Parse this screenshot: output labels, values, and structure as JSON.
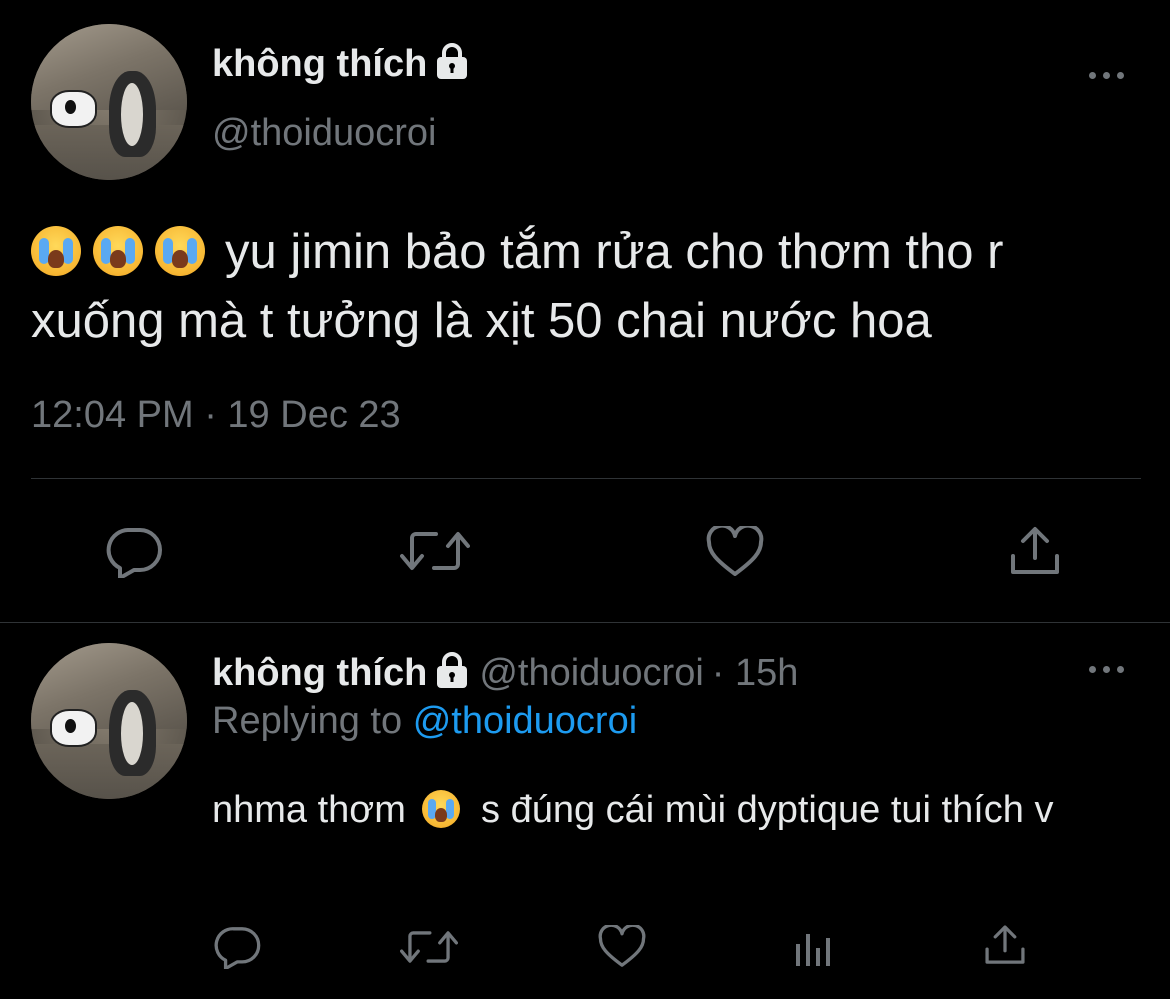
{
  "tweet": {
    "display_name": "không thích",
    "handle": "@thoiduocroi",
    "text": "yu jimin bảo tắm rửa cho thơm tho r xuống mà t tưởng là xịt 50 chai nước hoa",
    "emoji_prefix": [
      "loudly-crying-face",
      "loudly-crying-face",
      "loudly-crying-face"
    ],
    "timestamp": "12:04 PM · 19 Dec 23",
    "actions": [
      "reply-icon",
      "retweet-icon",
      "like-icon",
      "share-icon"
    ]
  },
  "reply": {
    "display_name": "không thích",
    "handle": "@thoiduocroi",
    "age": "· 15h",
    "replying_label": "Replying to",
    "replying_to": "@thoiduocroi",
    "text_before_emoji": "nhma thơm",
    "text_after_emoji": "s đúng cái mùi dyptique tui thích v",
    "actions": [
      "reply-icon",
      "retweet-icon",
      "like-icon",
      "analytics-icon",
      "share-icon"
    ]
  },
  "colors": {
    "background": "#000000",
    "text_primary": "#e7e9ea",
    "text_secondary": "#71767b",
    "link": "#1d9bf0",
    "divider": "#2f3336"
  }
}
